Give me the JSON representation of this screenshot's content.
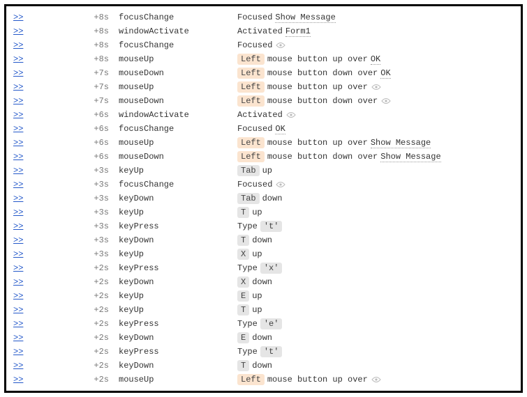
{
  "arrow_glyph": ">>",
  "rows": [
    {
      "time": "+8s",
      "event": "focusChange",
      "desc": [
        {
          "t": "text",
          "v": "Focused "
        },
        {
          "t": "ul",
          "v": "Show Message"
        }
      ]
    },
    {
      "time": "+8s",
      "event": "windowActivate",
      "desc": [
        {
          "t": "text",
          "v": "Activated "
        },
        {
          "t": "ul",
          "v": "Form1"
        }
      ]
    },
    {
      "time": "+8s",
      "event": "focusChange",
      "desc": [
        {
          "t": "text",
          "v": "Focused "
        },
        {
          "t": "eye"
        }
      ]
    },
    {
      "time": "+8s",
      "event": "mouseUp",
      "desc": [
        {
          "t": "tag-left",
          "v": "Left"
        },
        {
          "t": "text",
          "v": " mouse button up over "
        },
        {
          "t": "ul",
          "v": "OK"
        }
      ]
    },
    {
      "time": "+7s",
      "event": "mouseDown",
      "desc": [
        {
          "t": "tag-left",
          "v": "Left"
        },
        {
          "t": "text",
          "v": " mouse button down over "
        },
        {
          "t": "ul",
          "v": "OK"
        }
      ]
    },
    {
      "time": "+7s",
      "event": "mouseUp",
      "desc": [
        {
          "t": "tag-left",
          "v": "Left"
        },
        {
          "t": "text",
          "v": " mouse button up over "
        },
        {
          "t": "eye"
        }
      ]
    },
    {
      "time": "+7s",
      "event": "mouseDown",
      "desc": [
        {
          "t": "tag-left",
          "v": "Left"
        },
        {
          "t": "text",
          "v": " mouse button down over "
        },
        {
          "t": "eye"
        }
      ]
    },
    {
      "time": "+6s",
      "event": "windowActivate",
      "desc": [
        {
          "t": "text",
          "v": "Activated "
        },
        {
          "t": "eye"
        }
      ]
    },
    {
      "time": "+6s",
      "event": "focusChange",
      "desc": [
        {
          "t": "text",
          "v": "Focused "
        },
        {
          "t": "ul",
          "v": "OK"
        }
      ]
    },
    {
      "time": "+6s",
      "event": "mouseUp",
      "desc": [
        {
          "t": "tag-left",
          "v": "Left"
        },
        {
          "t": "text",
          "v": " mouse button up over "
        },
        {
          "t": "ul",
          "v": "Show Message"
        }
      ]
    },
    {
      "time": "+6s",
      "event": "mouseDown",
      "desc": [
        {
          "t": "tag-left",
          "v": "Left"
        },
        {
          "t": "text",
          "v": " mouse button down over "
        },
        {
          "t": "ul",
          "v": "Show Message"
        }
      ]
    },
    {
      "time": "+3s",
      "event": "keyUp",
      "desc": [
        {
          "t": "tag-key",
          "v": "Tab"
        },
        {
          "t": "text",
          "v": " up"
        }
      ]
    },
    {
      "time": "+3s",
      "event": "focusChange",
      "desc": [
        {
          "t": "text",
          "v": "Focused "
        },
        {
          "t": "eye"
        }
      ]
    },
    {
      "time": "+3s",
      "event": "keyDown",
      "desc": [
        {
          "t": "tag-key",
          "v": "Tab"
        },
        {
          "t": "text",
          "v": " down"
        }
      ]
    },
    {
      "time": "+3s",
      "event": "keyUp",
      "desc": [
        {
          "t": "tag-key",
          "v": "T"
        },
        {
          "t": "text",
          "v": " up"
        }
      ]
    },
    {
      "time": "+3s",
      "event": "keyPress",
      "desc": [
        {
          "t": "text",
          "v": "Type "
        },
        {
          "t": "tag-char",
          "v": "'t'"
        }
      ]
    },
    {
      "time": "+3s",
      "event": "keyDown",
      "desc": [
        {
          "t": "tag-key",
          "v": "T"
        },
        {
          "t": "text",
          "v": " down"
        }
      ]
    },
    {
      "time": "+3s",
      "event": "keyUp",
      "desc": [
        {
          "t": "tag-key",
          "v": "X"
        },
        {
          "t": "text",
          "v": " up"
        }
      ]
    },
    {
      "time": "+2s",
      "event": "keyPress",
      "desc": [
        {
          "t": "text",
          "v": "Type "
        },
        {
          "t": "tag-char",
          "v": "'x'"
        }
      ]
    },
    {
      "time": "+2s",
      "event": "keyDown",
      "desc": [
        {
          "t": "tag-key",
          "v": "X"
        },
        {
          "t": "text",
          "v": " down"
        }
      ]
    },
    {
      "time": "+2s",
      "event": "keyUp",
      "desc": [
        {
          "t": "tag-key",
          "v": "E"
        },
        {
          "t": "text",
          "v": " up"
        }
      ]
    },
    {
      "time": "+2s",
      "event": "keyUp",
      "desc": [
        {
          "t": "tag-key",
          "v": "T"
        },
        {
          "t": "text",
          "v": " up"
        }
      ]
    },
    {
      "time": "+2s",
      "event": "keyPress",
      "desc": [
        {
          "t": "text",
          "v": "Type "
        },
        {
          "t": "tag-char",
          "v": "'e'"
        }
      ]
    },
    {
      "time": "+2s",
      "event": "keyDown",
      "desc": [
        {
          "t": "tag-key",
          "v": "E"
        },
        {
          "t": "text",
          "v": " down"
        }
      ]
    },
    {
      "time": "+2s",
      "event": "keyPress",
      "desc": [
        {
          "t": "text",
          "v": "Type "
        },
        {
          "t": "tag-char",
          "v": "'t'"
        }
      ]
    },
    {
      "time": "+2s",
      "event": "keyDown",
      "desc": [
        {
          "t": "tag-key",
          "v": "T"
        },
        {
          "t": "text",
          "v": " down"
        }
      ]
    },
    {
      "time": "+2s",
      "event": "mouseUp",
      "desc": [
        {
          "t": "tag-left",
          "v": "Left"
        },
        {
          "t": "text",
          "v": " mouse button up over "
        },
        {
          "t": "eye"
        }
      ]
    }
  ]
}
